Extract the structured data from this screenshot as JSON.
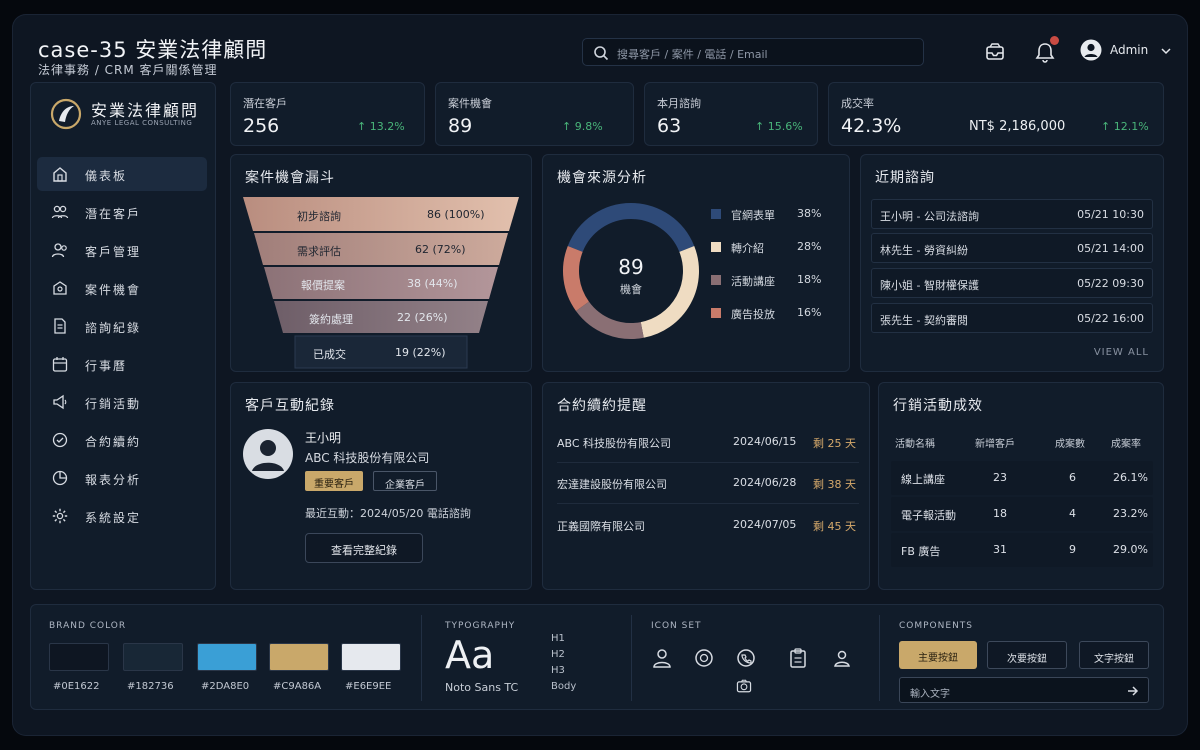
{
  "header": {
    "title": "case-35 安業法律顧問",
    "subtitle": "法律事務 / CRM 客戶關係管理",
    "search_placeholder": "搜尋客戶 / 案件 / 電話 / Email",
    "user": "Admin"
  },
  "sidebar": {
    "brand_name": "安業法律顧問",
    "brand_en": "ANYE LEGAL CONSULTING",
    "items": [
      {
        "label": "儀表板",
        "icon": "dashboard-icon"
      },
      {
        "label": "潛在客戶",
        "icon": "users-icon"
      },
      {
        "label": "客戶管理",
        "icon": "user-group-icon"
      },
      {
        "label": "案件機會",
        "icon": "briefcase-icon"
      },
      {
        "label": "諮詢紀錄",
        "icon": "document-icon"
      },
      {
        "label": "行事曆",
        "icon": "calendar-icon"
      },
      {
        "label": "行銷活動",
        "icon": "megaphone-icon"
      },
      {
        "label": "合約續約",
        "icon": "contract-icon"
      },
      {
        "label": "報表分析",
        "icon": "report-icon"
      },
      {
        "label": "系統設定",
        "icon": "gear-icon"
      }
    ]
  },
  "kpis": [
    {
      "label": "潛在客戶",
      "value": "256",
      "change": "13.2%"
    },
    {
      "label": "案件機會",
      "value": "89",
      "change": "9.8%"
    },
    {
      "label": "本月諮詢",
      "value": "63",
      "change": "15.6%"
    },
    {
      "label": "成交率",
      "value": "42.3%",
      "extra": "NT$ 2,186,000",
      "change": "12.1%"
    }
  ],
  "funnel": {
    "title": "案件機會漏斗",
    "stages": [
      {
        "label": "初步諮詢",
        "value": "86 (100%)"
      },
      {
        "label": "需求評估",
        "value": "62 (72%)"
      },
      {
        "label": "報價提案",
        "value": "38 (44%)"
      },
      {
        "label": "簽約處理",
        "value": "22 (26%)"
      },
      {
        "label": "已成交",
        "value": "19 (22%)"
      }
    ]
  },
  "source": {
    "title": "機會來源分析",
    "center_value": "89",
    "center_label": "機會",
    "items": [
      {
        "label": "官網表單",
        "percent": "38%",
        "share": 38,
        "color": "#2e4a78"
      },
      {
        "label": "轉介紹",
        "percent": "28%",
        "share": 28,
        "color": "#efdcc2"
      },
      {
        "label": "活動講座",
        "percent": "18%",
        "share": 18,
        "color": "#8a6f74"
      },
      {
        "label": "廣告投放",
        "percent": "16%",
        "share": 16,
        "color": "#c97b6a"
      }
    ]
  },
  "consults": {
    "title": "近期諮詢",
    "view_all": "VIEW ALL",
    "items": [
      {
        "name": "王小明 - 公司法諮詢",
        "time": "05/21  10:30"
      },
      {
        "name": "林先生 - 勞資糾紛",
        "time": "05/21  14:00"
      },
      {
        "name": "陳小姐 - 智財權保護",
        "time": "05/22  09:30"
      },
      {
        "name": "張先生 - 契約審閱",
        "time": "05/22  16:00"
      }
    ]
  },
  "interaction": {
    "title": "客戶互動紀錄",
    "name": "王小明",
    "company": "ABC 科技股份有限公司",
    "tag1": "重要客戶",
    "tag2": "企業客戶",
    "recent": "最近互動：2024/05/20 電話諮詢",
    "button": "查看完整紀錄"
  },
  "contracts": {
    "title": "合約續約提醒",
    "items": [
      {
        "company": "ABC 科技股份有限公司",
        "date": "2024/06/15",
        "remain": "剩 25 天"
      },
      {
        "company": "宏達建設股份有限公司",
        "date": "2024/06/28",
        "remain": "剩 38 天"
      },
      {
        "company": "正義國際有限公司",
        "date": "2024/07/05",
        "remain": "剩 45 天"
      }
    ]
  },
  "marketing": {
    "title": "行銷活動成效",
    "headers": [
      "活動名稱",
      "新增客戶",
      "成案數",
      "成案率"
    ],
    "rows": [
      [
        "線上講座",
        "23",
        "6",
        "26.1%"
      ],
      [
        "電子報活動",
        "18",
        "4",
        "23.2%"
      ],
      [
        "FB 廣告",
        "31",
        "9",
        "29.0%"
      ]
    ]
  },
  "brand": {
    "label": "BRAND COLOR",
    "colors": [
      {
        "hex": "#0E1622",
        "color": "#0E1622"
      },
      {
        "hex": "#182736",
        "color": "#182736"
      },
      {
        "hex": "#2DA8E0",
        "color": "#3a9fd6"
      },
      {
        "hex": "#C9A86A",
        "color": "#C9A86A"
      },
      {
        "hex": "#E6E9EE",
        "color": "#E6E9EE"
      }
    ]
  },
  "typography": {
    "label": "TYPOGRAPHY",
    "sample": "Aa",
    "font_name": "Noto Sans TC",
    "levels": [
      "H1",
      "H2",
      "H3",
      "Body"
    ]
  },
  "iconset": {
    "label": "ICON SET"
  },
  "components": {
    "label": "COMPONENTS",
    "primary": "主要按鈕",
    "secondary": "次要按鈕",
    "text_btn": "文字按鈕",
    "input_placeholder": "輸入文字"
  }
}
